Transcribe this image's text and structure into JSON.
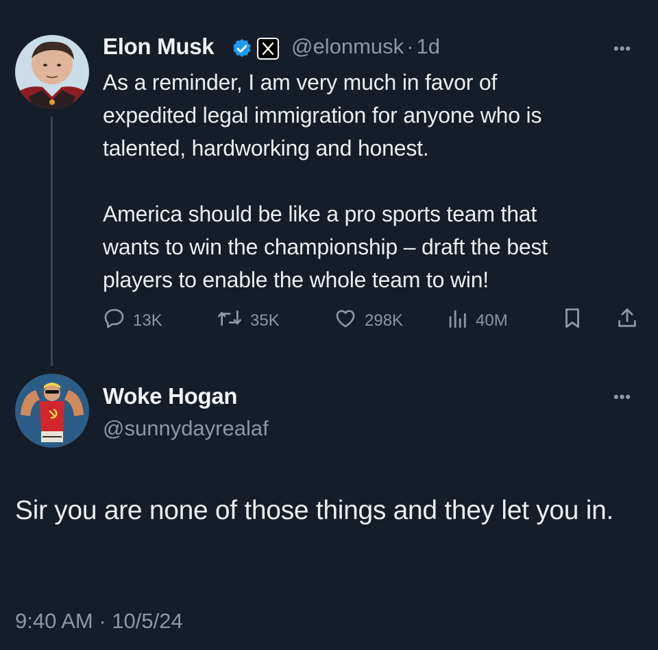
{
  "tweet": {
    "author_name": "Elon Musk",
    "author_handle": "@elonmusk",
    "separator": "·",
    "time_ago": "1d",
    "verified_color": "#1d9bf0",
    "text": "As a reminder, I am very much in favor of\nexpedited legal immigration for anyone who is\ntalented, hardworking and honest.\n\nAmerica should be like a pro sports team that\nwants to win the championship – draft the best\nplayers to enable the whole team to win!",
    "more_label": "•••",
    "stats": {
      "replies": "13K",
      "reposts": "35K",
      "likes": "298K",
      "views": "40M"
    }
  },
  "reply": {
    "author_name": "Woke Hogan",
    "author_handle": "@sunnydayrealaf",
    "more_label": "•••",
    "text": "Sir you are none of those things and they let you in.",
    "timestamp": "9:40 AM · 10/5/24"
  },
  "icons": [
    "verified-badge-icon",
    "x-logo-badge-icon",
    "more-options-icon",
    "reply-icon",
    "repost-icon",
    "like-icon",
    "views-icon",
    "bookmark-icon",
    "share-icon"
  ]
}
